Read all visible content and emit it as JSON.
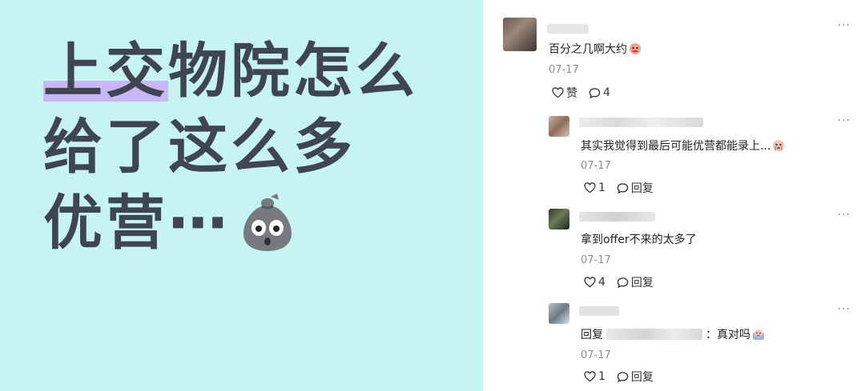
{
  "headline": {
    "line1_mark": "上交",
    "line1_rest": "物院怎么",
    "line2": "给了这么多",
    "line3": "优营⋯"
  },
  "comments": [
    {
      "text": "百分之几啊大约",
      "date": "07-17",
      "like_label": "赞",
      "reply_count": "4",
      "more": "···"
    },
    {
      "text": "其实我觉得到最后可能优营都能录上...",
      "date": "07-17",
      "like_count": "1",
      "reply_label": "回复",
      "more": "···"
    },
    {
      "text": "拿到offer不来的太多了",
      "date": "07-17",
      "like_count": "4",
      "reply_label": "回复",
      "more": "···"
    },
    {
      "text_prefix": "回复",
      "text_suffix": "：真对吗",
      "date": "07-17",
      "like_count": "1",
      "reply_label": "回复",
      "more": "···"
    }
  ],
  "colors": {
    "left_bg": "#c6f4f2",
    "headline": "#3f4651",
    "highlight": "#c9b6f6"
  }
}
